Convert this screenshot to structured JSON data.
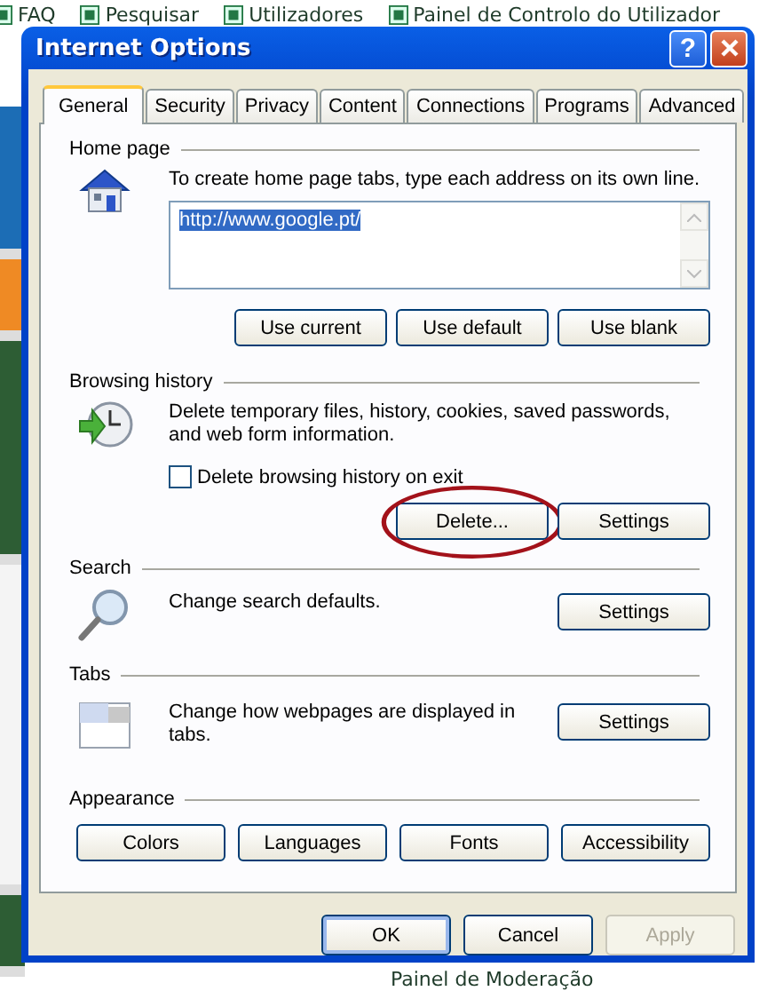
{
  "page_links": [
    {
      "label": "FAQ"
    },
    {
      "label": "Pesquisar"
    },
    {
      "label": "Utilizadores"
    },
    {
      "label": "Painel de Controlo do Utilizador"
    }
  ],
  "bottom_link": {
    "label": "Painel de Moderação"
  },
  "window": {
    "title": "Internet Options",
    "help_button": "?"
  },
  "tabs": [
    {
      "label": "General",
      "selected": true
    },
    {
      "label": "Security",
      "selected": false
    },
    {
      "label": "Privacy",
      "selected": false
    },
    {
      "label": "Content",
      "selected": false
    },
    {
      "label": "Connections",
      "selected": false
    },
    {
      "label": "Programs",
      "selected": false
    },
    {
      "label": "Advanced",
      "selected": false
    }
  ],
  "sections": [
    {
      "kind": "home",
      "title": "Home page",
      "description": "To create home page tabs, type each address on its own line.",
      "field": {
        "value": "http://www.google.pt/",
        "value_selected": true
      },
      "buttons": [
        {
          "label": "Use current",
          "circled": false
        },
        {
          "label": "Use default",
          "circled": false
        },
        {
          "label": "Use blank",
          "circled": false
        }
      ]
    },
    {
      "kind": "history",
      "title": "Browsing history",
      "description": "Delete temporary files, history, cookies, saved passwords, and web form information.",
      "checkbox": {
        "label": "Delete browsing history on exit",
        "checked": false
      },
      "buttons": [
        {
          "label": "Delete...",
          "circled": true
        },
        {
          "label": "Settings",
          "circled": false
        }
      ]
    },
    {
      "kind": "search",
      "title": "Search",
      "description": "Change search defaults.",
      "buttons": [
        {
          "label": "Settings"
        }
      ]
    },
    {
      "kind": "tabs",
      "title": "Tabs",
      "description": "Change how webpages are displayed in tabs.",
      "buttons": [
        {
          "label": "Settings"
        }
      ]
    },
    {
      "kind": "appearance",
      "title": "Appearance",
      "buttons": [
        {
          "label": "Colors",
          "circled": false
        },
        {
          "label": "Languages",
          "circled": false
        },
        {
          "label": "Fonts",
          "circled": false
        },
        {
          "label": "Accessibility",
          "circled": false
        }
      ]
    }
  ],
  "footer_buttons": [
    {
      "label": "OK",
      "default": true,
      "disabled": false
    },
    {
      "label": "Cancel",
      "default": false,
      "disabled": false
    },
    {
      "label": "Apply",
      "default": false,
      "disabled": true
    }
  ]
}
